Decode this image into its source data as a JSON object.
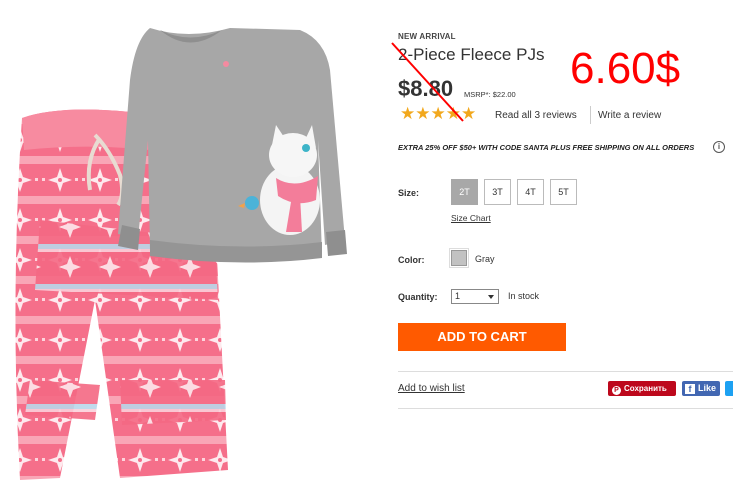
{
  "product": {
    "badge": "NEW ARRIVAL",
    "title": "2-Piece Fleece PJs",
    "price": "$8.80",
    "msrp": "MSRP*: $22.00",
    "rating_stars": "★★★★★",
    "read_reviews": "Read all 3 reviews",
    "write_review": "Write a review",
    "promo": "EXTRA 25% OFF $50+ WITH CODE SANTA PLUS FREE SHIPPING ON ALL ORDERS",
    "promo_info_icon": "i"
  },
  "size": {
    "label": "Size:",
    "options": [
      "2T",
      "3T",
      "4T",
      "5T"
    ],
    "selected": "2T",
    "chart_link": "Size Chart"
  },
  "color": {
    "label": "Color:",
    "name": "Gray",
    "swatch": "#c2c2c2"
  },
  "quantity": {
    "label": "Quantity:",
    "value": "1",
    "stock": "In stock"
  },
  "actions": {
    "add_to_cart": "ADD TO CART",
    "wish_list": "Add to wish list",
    "pinterest": "Сохранить",
    "facebook": "Like"
  },
  "annotation": {
    "new_price": "6.60$"
  },
  "colors": {
    "accent": "#ff5a00",
    "stars": "#f2a81d",
    "annotation": "#ff0000",
    "pinterest": "#bd081c",
    "facebook": "#4267b2"
  }
}
